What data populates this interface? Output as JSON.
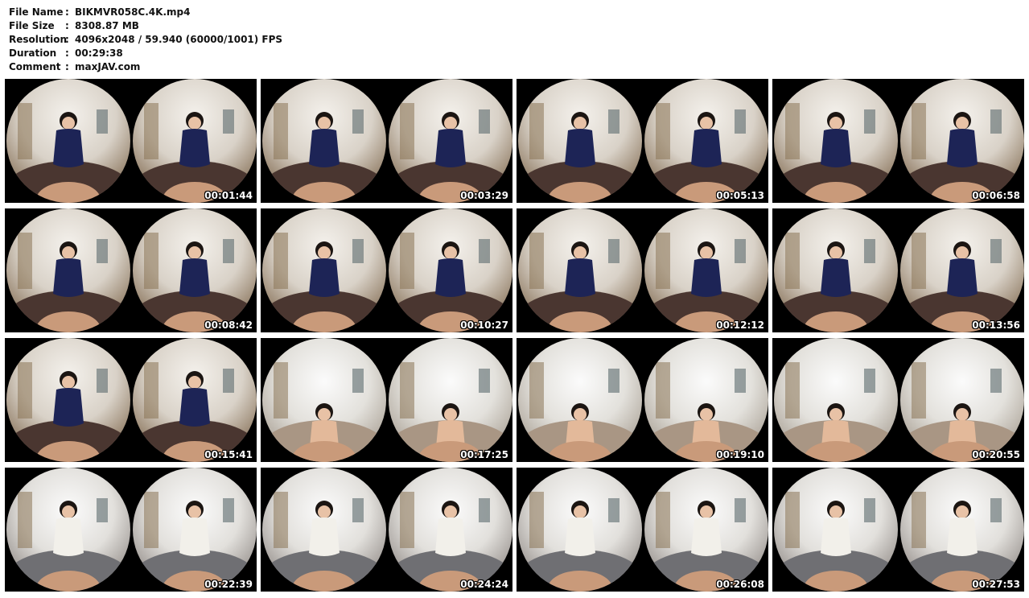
{
  "info": [
    {
      "key": "File Name",
      "sep": ":",
      "value": "BIKMVR058C.4K.mp4"
    },
    {
      "key": "File Size",
      "sep": ":",
      "value": "8308.87 MB"
    },
    {
      "key": "Resolution",
      "sep": ":",
      "value": "4096x2048 / 59.940 (60000/1001) FPS"
    },
    {
      "key": "Duration",
      "sep": ":",
      "value": "00:29:38"
    },
    {
      "key": "Comment",
      "sep": ":",
      "value": "maxJAV.com"
    }
  ],
  "thumbnails": [
    {
      "time": "00:01:44",
      "scene": "bedroom",
      "outfit": "swimsuit"
    },
    {
      "time": "00:03:29",
      "scene": "bedroom",
      "outfit": "swimsuit"
    },
    {
      "time": "00:05:13",
      "scene": "bedroom",
      "outfit": "swimsuit"
    },
    {
      "time": "00:06:58",
      "scene": "bedroom",
      "outfit": "swimsuit"
    },
    {
      "time": "00:08:42",
      "scene": "bedroom",
      "outfit": "swimsuit"
    },
    {
      "time": "00:10:27",
      "scene": "bedroom",
      "outfit": "swimsuit"
    },
    {
      "time": "00:12:12",
      "scene": "bedroom",
      "outfit": "swimsuit"
    },
    {
      "time": "00:13:56",
      "scene": "bedroom",
      "outfit": "swimsuit"
    },
    {
      "time": "00:15:41",
      "scene": "bedroom",
      "outfit": "swimsuit"
    },
    {
      "time": "00:17:25",
      "scene": "bath",
      "outfit": "none"
    },
    {
      "time": "00:19:10",
      "scene": "bath",
      "outfit": "none"
    },
    {
      "time": "00:20:55",
      "scene": "bath",
      "outfit": "none"
    },
    {
      "time": "00:22:39",
      "scene": "mat",
      "outfit": "uniform"
    },
    {
      "time": "00:24:24",
      "scene": "mat",
      "outfit": "uniform"
    },
    {
      "time": "00:26:08",
      "scene": "mat",
      "outfit": "uniform"
    },
    {
      "time": "00:27:53",
      "scene": "mat",
      "outfit": "uniform"
    }
  ],
  "colors": {
    "page_bg": "#ffffff",
    "tile_bg": "#000000",
    "timestamp": "#ffffff"
  }
}
